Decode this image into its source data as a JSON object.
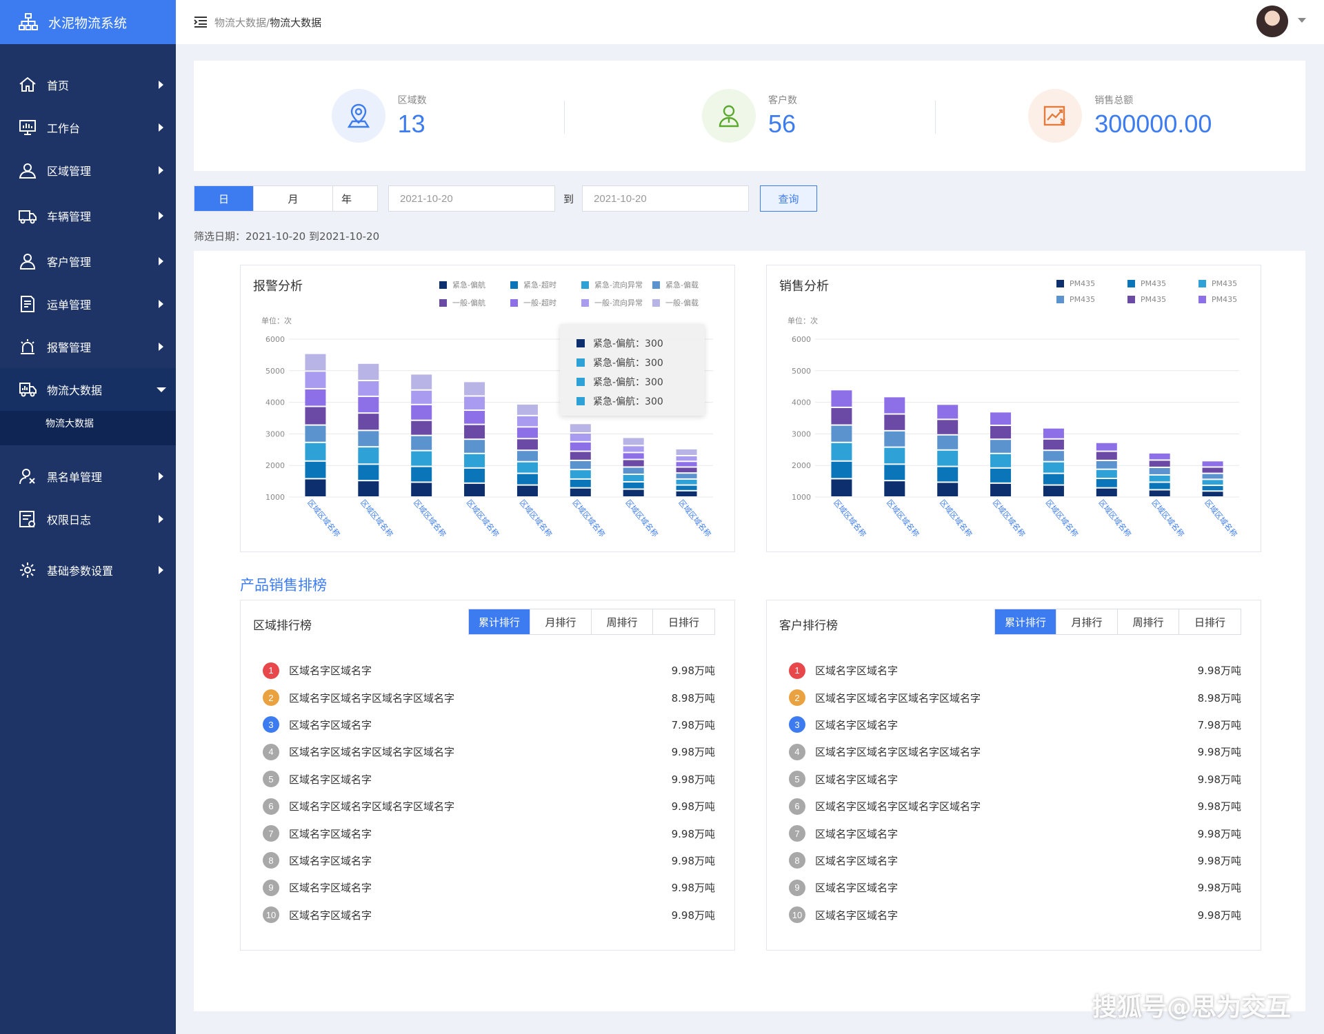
{
  "app": {
    "title": "水泥物流系统"
  },
  "sidebar": {
    "items": [
      {
        "label": "首页",
        "icon": "home-icon"
      },
      {
        "label": "工作台",
        "icon": "dashboard-icon"
      },
      {
        "label": "区域管理",
        "icon": "location-icon"
      },
      {
        "label": "车辆管理",
        "icon": "truck-icon"
      },
      {
        "label": "客户管理",
        "icon": "user-icon"
      },
      {
        "label": "运单管理",
        "icon": "document-icon"
      },
      {
        "label": "报警管理",
        "icon": "alarm-icon"
      },
      {
        "label": "物流大数据",
        "icon": "data-truck-icon"
      },
      {
        "label": "黑名单管理",
        "icon": "blacklist-icon"
      },
      {
        "label": "权限日志",
        "icon": "log-icon"
      },
      {
        "label": "基础参数设置",
        "icon": "gear-icon"
      }
    ],
    "submenu": {
      "label": "物流大数据"
    }
  },
  "header": {
    "crumb_parent": "物流大数据/",
    "crumb_current": "物流大数据"
  },
  "stats": [
    {
      "label": "区域数",
      "value": "13"
    },
    {
      "label": "客户数",
      "value": "56"
    },
    {
      "label": "销售总额",
      "value": "300000.00"
    }
  ],
  "filter": {
    "tabs": [
      "日",
      "月",
      "年"
    ],
    "start": "2021-10-20",
    "to": "到",
    "end": "2021-10-20",
    "query": "查询",
    "info": "筛选日期：2021-10-20 到2021-10-20"
  },
  "colors": {
    "accent": "#3d7cf0",
    "sidebar": "#1e3467",
    "series": [
      "#0d2f6e",
      "#0a75b8",
      "#2ea1d6",
      "#5b93cf",
      "#6b4aa6",
      "#8d6fe8",
      "#a89bf0",
      "#b9b4e6"
    ]
  },
  "chart_data": [
    {
      "type": "bar",
      "title": "报警分析",
      "unit": "单位：次",
      "stacked": true,
      "ylim": [
        1000,
        6000
      ],
      "yticks": [
        1000,
        2000,
        3000,
        4000,
        5000,
        6000
      ],
      "categories": [
        "区域区域名称",
        "区域区域名称",
        "区域区域名称",
        "区域区域名称",
        "区域区域名称",
        "区域区域名称",
        "区域区域名称",
        "区域区域名称"
      ],
      "series": [
        {
          "name": "紧急-偏航",
          "values": [
            580,
            520,
            470,
            440,
            380,
            290,
            250,
            200
          ]
        },
        {
          "name": "紧急-超时",
          "values": [
            560,
            520,
            500,
            480,
            370,
            280,
            230,
            180
          ]
        },
        {
          "name": "紧急-流向异常",
          "values": [
            590,
            550,
            500,
            460,
            370,
            300,
            240,
            190
          ]
        },
        {
          "name": "紧急-偏载",
          "values": [
            550,
            520,
            480,
            450,
            360,
            290,
            230,
            190
          ]
        },
        {
          "name": "一般-偏航",
          "values": [
            590,
            550,
            480,
            470,
            370,
            290,
            240,
            190
          ]
        },
        {
          "name": "一般-超时",
          "values": [
            560,
            530,
            500,
            450,
            370,
            300,
            220,
            180
          ]
        },
        {
          "name": "一般-流向异常",
          "values": [
            560,
            500,
            460,
            450,
            360,
            280,
            220,
            180
          ]
        },
        {
          "name": "一般-偏载",
          "values": [
            560,
            550,
            510,
            460,
            370,
            300,
            260,
            220
          ]
        }
      ],
      "tooltip": [
        {
          "label": "紧急-偏航：300"
        },
        {
          "label": "紧急-偏航：300"
        },
        {
          "label": "紧急-偏航：300"
        },
        {
          "label": "紧急-偏航：300"
        }
      ]
    },
    {
      "type": "bar",
      "title": "销售分析",
      "unit": "单位：次",
      "stacked": true,
      "ylim": [
        1000,
        6000
      ],
      "yticks": [
        1000,
        2000,
        3000,
        4000,
        5000,
        6000
      ],
      "categories": [
        "区域区域名称",
        "区域区域名称",
        "区域区域名称",
        "区域区域名称",
        "区域区域名称",
        "区域区域名称",
        "区域区域名称",
        "区域区域名称"
      ],
      "series": [
        {
          "name": "PM435",
          "values": [
            580,
            520,
            470,
            440,
            380,
            290,
            230,
            190
          ]
        },
        {
          "name": "PM435",
          "values": [
            560,
            520,
            500,
            480,
            370,
            300,
            240,
            180
          ]
        },
        {
          "name": "PM435",
          "values": [
            590,
            540,
            520,
            460,
            370,
            290,
            230,
            190
          ]
        },
        {
          "name": "PM435",
          "values": [
            550,
            520,
            480,
            450,
            360,
            280,
            240,
            190
          ]
        },
        {
          "name": "PM435",
          "values": [
            560,
            530,
            490,
            440,
            360,
            290,
            230,
            200
          ]
        },
        {
          "name": "PM435",
          "values": [
            560,
            550,
            480,
            430,
            350,
            280,
            230,
            200
          ]
        }
      ]
    }
  ],
  "ranking": {
    "title": "产品销售排榜",
    "tabs": [
      "累计排行",
      "月排行",
      "周排行",
      "日排行"
    ],
    "region": {
      "title": "区域排行榜",
      "rows": [
        {
          "rank": "1",
          "name": "区域名字区域名字",
          "value": "9.98万吨"
        },
        {
          "rank": "2",
          "name": "区域名字区域名字区域名字区域名字",
          "value": "8.98万吨"
        },
        {
          "rank": "3",
          "name": "区域名字区域名字",
          "value": "7.98万吨"
        },
        {
          "rank": "4",
          "name": "区域名字区域名字区域名字区域名字",
          "value": "9.98万吨"
        },
        {
          "rank": "5",
          "name": "区域名字区域名字",
          "value": "9.98万吨"
        },
        {
          "rank": "6",
          "name": "区域名字区域名字区域名字区域名字",
          "value": "9.98万吨"
        },
        {
          "rank": "7",
          "name": "区域名字区域名字",
          "value": "9.98万吨"
        },
        {
          "rank": "8",
          "name": "区域名字区域名字",
          "value": "9.98万吨"
        },
        {
          "rank": "9",
          "name": "区域名字区域名字",
          "value": "9.98万吨"
        },
        {
          "rank": "10",
          "name": "区域名字区域名字",
          "value": "9.98万吨"
        }
      ]
    },
    "customer": {
      "title": "客户排行榜",
      "rows": [
        {
          "rank": "1",
          "name": "区域名字区域名字",
          "value": "9.98万吨"
        },
        {
          "rank": "2",
          "name": "区域名字区域名字区域名字区域名字",
          "value": "8.98万吨"
        },
        {
          "rank": "3",
          "name": "区域名字区域名字",
          "value": "7.98万吨"
        },
        {
          "rank": "4",
          "name": "区域名字区域名字区域名字区域名字",
          "value": "9.98万吨"
        },
        {
          "rank": "5",
          "name": "区域名字区域名字",
          "value": "9.98万吨"
        },
        {
          "rank": "6",
          "name": "区域名字区域名字区域名字区域名字",
          "value": "9.98万吨"
        },
        {
          "rank": "7",
          "name": "区域名字区域名字",
          "value": "9.98万吨"
        },
        {
          "rank": "8",
          "name": "区域名字区域名字",
          "value": "9.98万吨"
        },
        {
          "rank": "9",
          "name": "区域名字区域名字",
          "value": "9.98万吨"
        },
        {
          "rank": "10",
          "name": "区域名字区域名字",
          "value": "9.98万吨"
        }
      ]
    }
  },
  "watermark": "搜狐号@思为交互"
}
